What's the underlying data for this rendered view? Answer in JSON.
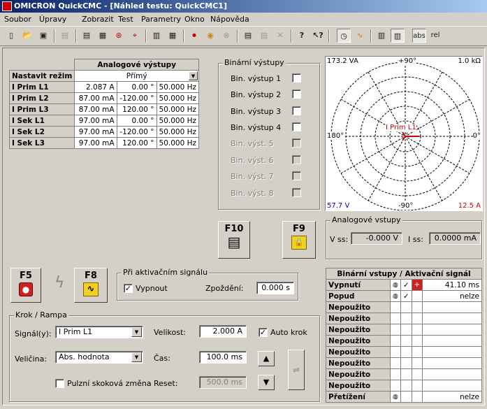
{
  "window": {
    "title": "OMICRON QuickCMC - [Náhled testu: QuickCMC1]"
  },
  "menu": [
    "Soubor",
    "Úpravy",
    "Zobrazit",
    "Test",
    "Parametry",
    "Okno",
    "Nápověda"
  ],
  "toolbar": {
    "abs": "abs",
    "rel": "rel"
  },
  "analog": {
    "title": "Analogové výstupy",
    "mode_label": "Nastavit režim",
    "mode_value": "Přímý",
    "rows": [
      {
        "name": "I Prim L1",
        "mag": "2.087 A",
        "ang": "0.00 °",
        "freq": "50.000 Hz"
      },
      {
        "name": "I Prim L2",
        "mag": "87.00 mA",
        "ang": "-120.00 °",
        "freq": "50.000 Hz"
      },
      {
        "name": "I Prim L3",
        "mag": "87.00 mA",
        "ang": "120.00 °",
        "freq": "50.000 Hz"
      },
      {
        "name": "I Sek L1",
        "mag": "97.00 mA",
        "ang": "0.00 °",
        "freq": "50.000 Hz"
      },
      {
        "name": "I Sek L2",
        "mag": "97.00 mA",
        "ang": "-120.00 °",
        "freq": "50.000 Hz"
      },
      {
        "name": "I Sek L3",
        "mag": "97.00 mA",
        "ang": "120.00 °",
        "freq": "50.000 Hz"
      }
    ]
  },
  "binout": {
    "title": "Binární výstupy",
    "items": [
      "Bin. výstup 1",
      "Bin. výstup 2",
      "Bin. výstup 3",
      "Bin. výstup 4",
      "Bin. výst. 5",
      "Bin. výst. 6",
      "Bin. výst. 7",
      "Bin. výst. 8"
    ]
  },
  "polar": {
    "tl": "173.2 VA",
    "top": "+90°",
    "tr": "1.0 kΩ",
    "left": "180°",
    "right": "0°",
    "bottom": "-90°",
    "bl": "57.7 V",
    "br": "12.5 A",
    "vector_label": "I Prim L1"
  },
  "keys": {
    "f10": "F10",
    "f9": "F9",
    "f5": "F5",
    "f8": "F8"
  },
  "analog_in": {
    "title": "Analogové vstupy",
    "vss_label": "V ss:",
    "vss": "-0.000 V",
    "iss_label": "I ss:",
    "iss": "0.0000 mA"
  },
  "trigger": {
    "title": "Při aktivačním signálu",
    "trip_label": "Vypnout",
    "trip_checked": "✓",
    "delay_label": "Zpoždění:",
    "delay": "0.000 s"
  },
  "ramp": {
    "title": "Krok / Rampa",
    "signal_label": "Signál(y):",
    "signal": "I Prim L1",
    "quantity_label": "Veličina:",
    "quantity": "Abs. hodnota",
    "pulse_label": "Pulzní skoková změna",
    "size_label": "Velikost:",
    "size": "2.000 A",
    "auto_label": "Auto krok",
    "auto_checked": "✓",
    "time_label": "Čas:",
    "time": "100.0 ms",
    "reset_label": "Reset:",
    "reset": "500.0 ms"
  },
  "binin": {
    "title": "Binární vstupy / Aktivační signál",
    "rows": [
      {
        "name": "Vypnutí",
        "check": "✓",
        "value": "41.10 ms"
      },
      {
        "name": "Popud",
        "check": "✓",
        "value": "nelze"
      },
      {
        "name": "Nepoužito",
        "check": "",
        "value": ""
      },
      {
        "name": "Nepoužito",
        "check": "",
        "value": ""
      },
      {
        "name": "Nepoužito",
        "check": "",
        "value": ""
      },
      {
        "name": "Nepoužito",
        "check": "",
        "value": ""
      },
      {
        "name": "Nepoužito",
        "check": "",
        "value": ""
      },
      {
        "name": "Nepoužito",
        "check": "",
        "value": ""
      },
      {
        "name": "Nepoužito",
        "check": "",
        "value": ""
      },
      {
        "name": "Nepoužito",
        "check": "",
        "value": ""
      },
      {
        "name": "Přetížení",
        "check": "",
        "value": "nelze"
      }
    ]
  },
  "colors": {
    "accent": "#0a246a",
    "vector": "#cc0000",
    "alarm": "#cc2222",
    "key_yellow": "#f0d020"
  }
}
